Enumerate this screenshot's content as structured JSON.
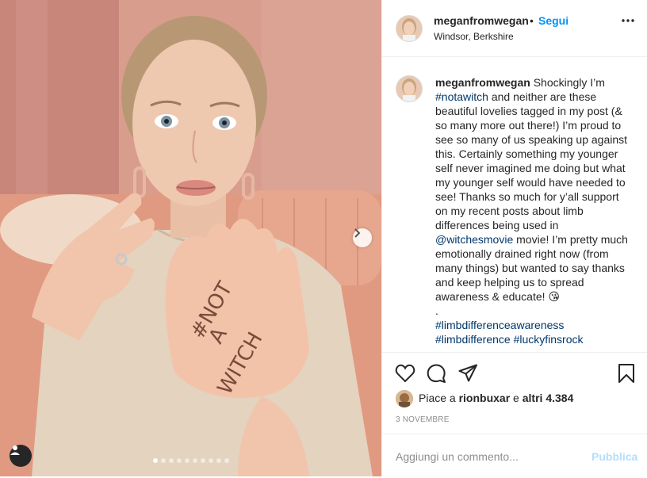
{
  "post": {
    "username": "meganfromwegan",
    "follow_separator": "•",
    "follow_label": "Segui",
    "location": "Windsor, Berkshire"
  },
  "caption": {
    "username": "meganfromwegan",
    "seg1": " Shockingly I’m ",
    "tag1": "#notawitch",
    "seg2": " and neither are these beautiful lovelies tagged in my post (& so many more out there!) I’m proud to see so many of us speaking up against this. Certainly something my younger self never imagined me doing but what my younger self would have needed to see! Thanks so much for y’all support on my recent posts about limb differences being used in ",
    "mention": "@witchesmovie",
    "seg3": " movie! I’m pretty much emotionally drained right now (from many things) but wanted to say thanks and keep helping us to spread awareness & educate! ",
    "emoji": "😘",
    "dot": ".",
    "tag2": "#limbdifferenceawareness",
    "tag3": "#limbdifference",
    "tag4": "#luckyfinsrock"
  },
  "likes": {
    "prefix": "Piace a ",
    "user": "rionbuxar",
    "middle": " e ",
    "count": "altri 4.384"
  },
  "date": "3 NOVEMBRE",
  "comment": {
    "placeholder": "Aggiungi un commento...",
    "publish_label": "Pubblica"
  },
  "carousel": {
    "slides": 10,
    "active_index": 0
  },
  "photo": {
    "hand_text": "#NOT A WITCH"
  },
  "icons": [
    "heart-icon",
    "comment-icon",
    "share-icon",
    "save-icon",
    "more-icon",
    "next-arrow-icon",
    "user-tag-icon"
  ],
  "colors": {
    "link": "#0095f6",
    "hashtag": "#00376b",
    "publish_disabled": "#b2dffc",
    "muted": "#8e8e8e"
  }
}
